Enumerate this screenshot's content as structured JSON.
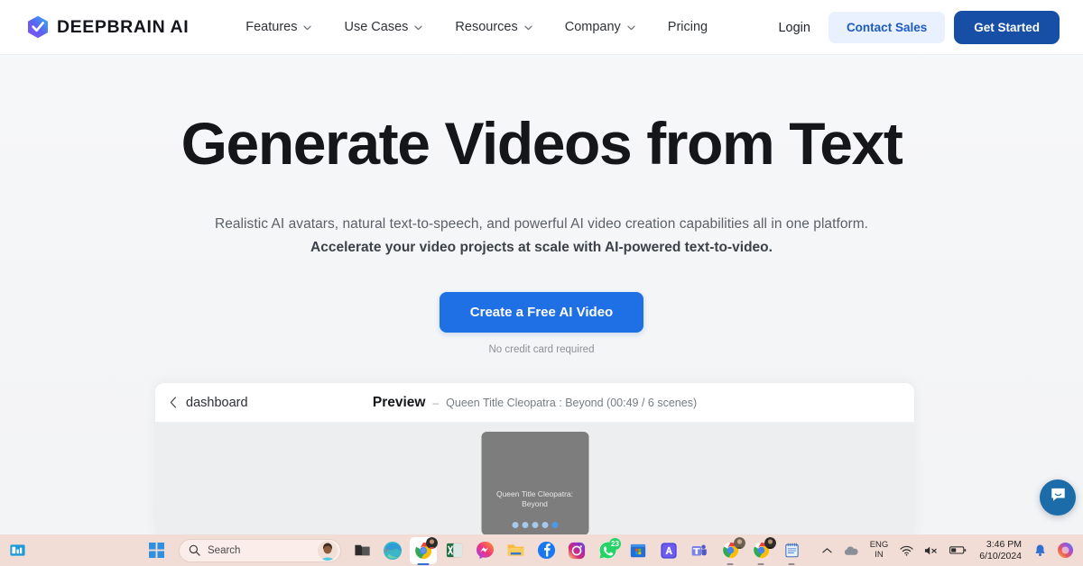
{
  "site": {
    "brand_name": "DEEPBRAIN AI",
    "brand_primary": "#174ea6",
    "accent_blue": "#1f6fe5"
  },
  "header": {
    "nav": [
      {
        "label": "Features",
        "has_dropdown": true
      },
      {
        "label": "Use Cases",
        "has_dropdown": true
      },
      {
        "label": "Resources",
        "has_dropdown": true
      },
      {
        "label": "Company",
        "has_dropdown": true
      },
      {
        "label": "Pricing",
        "has_dropdown": false
      }
    ],
    "login_label": "Login",
    "contact_label": "Contact Sales",
    "get_started_label": "Get Started"
  },
  "hero": {
    "title": "Generate Videos from Text",
    "subtitle_line1": "Realistic AI avatars, natural text-to-speech, and powerful AI video creation capabilities all in one platform.",
    "subtitle_line2": "Accelerate your video projects at scale with AI-powered text-to-video.",
    "cta_label": "Create a Free AI Video",
    "cta_note": "No credit card required"
  },
  "preview": {
    "back_label": "dashboard",
    "title": "Preview",
    "separator": "–",
    "meta": "Queen Title Cleopatra : Beyond (00:49 / 6 scenes)",
    "video_caption": "Queen Title Cleopatra: Beyond",
    "dots_total": 5,
    "dots_active_index": 4
  },
  "chat": {
    "launcher_name": "Intercom chat",
    "color": "#1b6ca8"
  },
  "taskbar": {
    "search_placeholder": "Search",
    "pinned": [
      {
        "name": "microsoft-edge",
        "label": "Microsoft Edge"
      },
      {
        "name": "google-chrome-active",
        "label": "Google Chrome"
      },
      {
        "name": "microsoft-excel",
        "label": "Microsoft Excel"
      },
      {
        "name": "messenger",
        "label": "Messenger"
      },
      {
        "name": "file-explorer",
        "label": "File Explorer"
      },
      {
        "name": "facebook",
        "label": "Facebook"
      },
      {
        "name": "instagram",
        "label": "Instagram"
      },
      {
        "name": "whatsapp",
        "label": "WhatsApp",
        "badge": "23"
      },
      {
        "name": "microsoft-store",
        "label": "Microsoft Store"
      },
      {
        "name": "adobe-illustrator",
        "label": "Adobe Illustrator"
      },
      {
        "name": "microsoft-teams",
        "label": "Microsoft Teams"
      },
      {
        "name": "chrome-profile-1",
        "label": "Chrome Profile"
      },
      {
        "name": "chrome-profile-2",
        "label": "Chrome Profile"
      },
      {
        "name": "notepad",
        "label": "Notepad"
      }
    ],
    "tray": {
      "language_line1": "ENG",
      "language_line2": "IN",
      "time": "3:46 PM",
      "date": "6/10/2024"
    }
  }
}
